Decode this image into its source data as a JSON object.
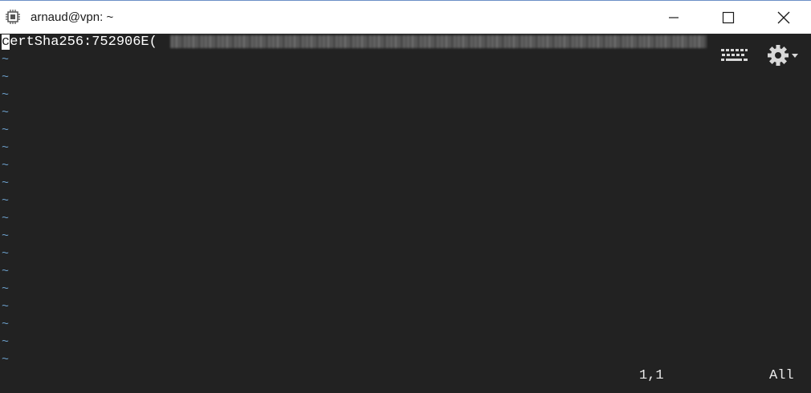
{
  "window": {
    "title": "arnaud@vpn: ~",
    "app_icon": "chip-icon",
    "controls": [
      "minimize-icon",
      "maximize-icon",
      "close-icon"
    ]
  },
  "terminal": {
    "first_line": {
      "cursor_char": "c",
      "text_after_cursor": "ertSha256:752906E("
    },
    "tilde_char": "~",
    "status": {
      "position": "1,1",
      "scroll": "All"
    },
    "overlay_icons": [
      "keyboard-icon",
      "gear-icon"
    ],
    "colors": {
      "background": "#222222",
      "text": "#ffffff",
      "tilde": "#6b9ec9"
    }
  }
}
